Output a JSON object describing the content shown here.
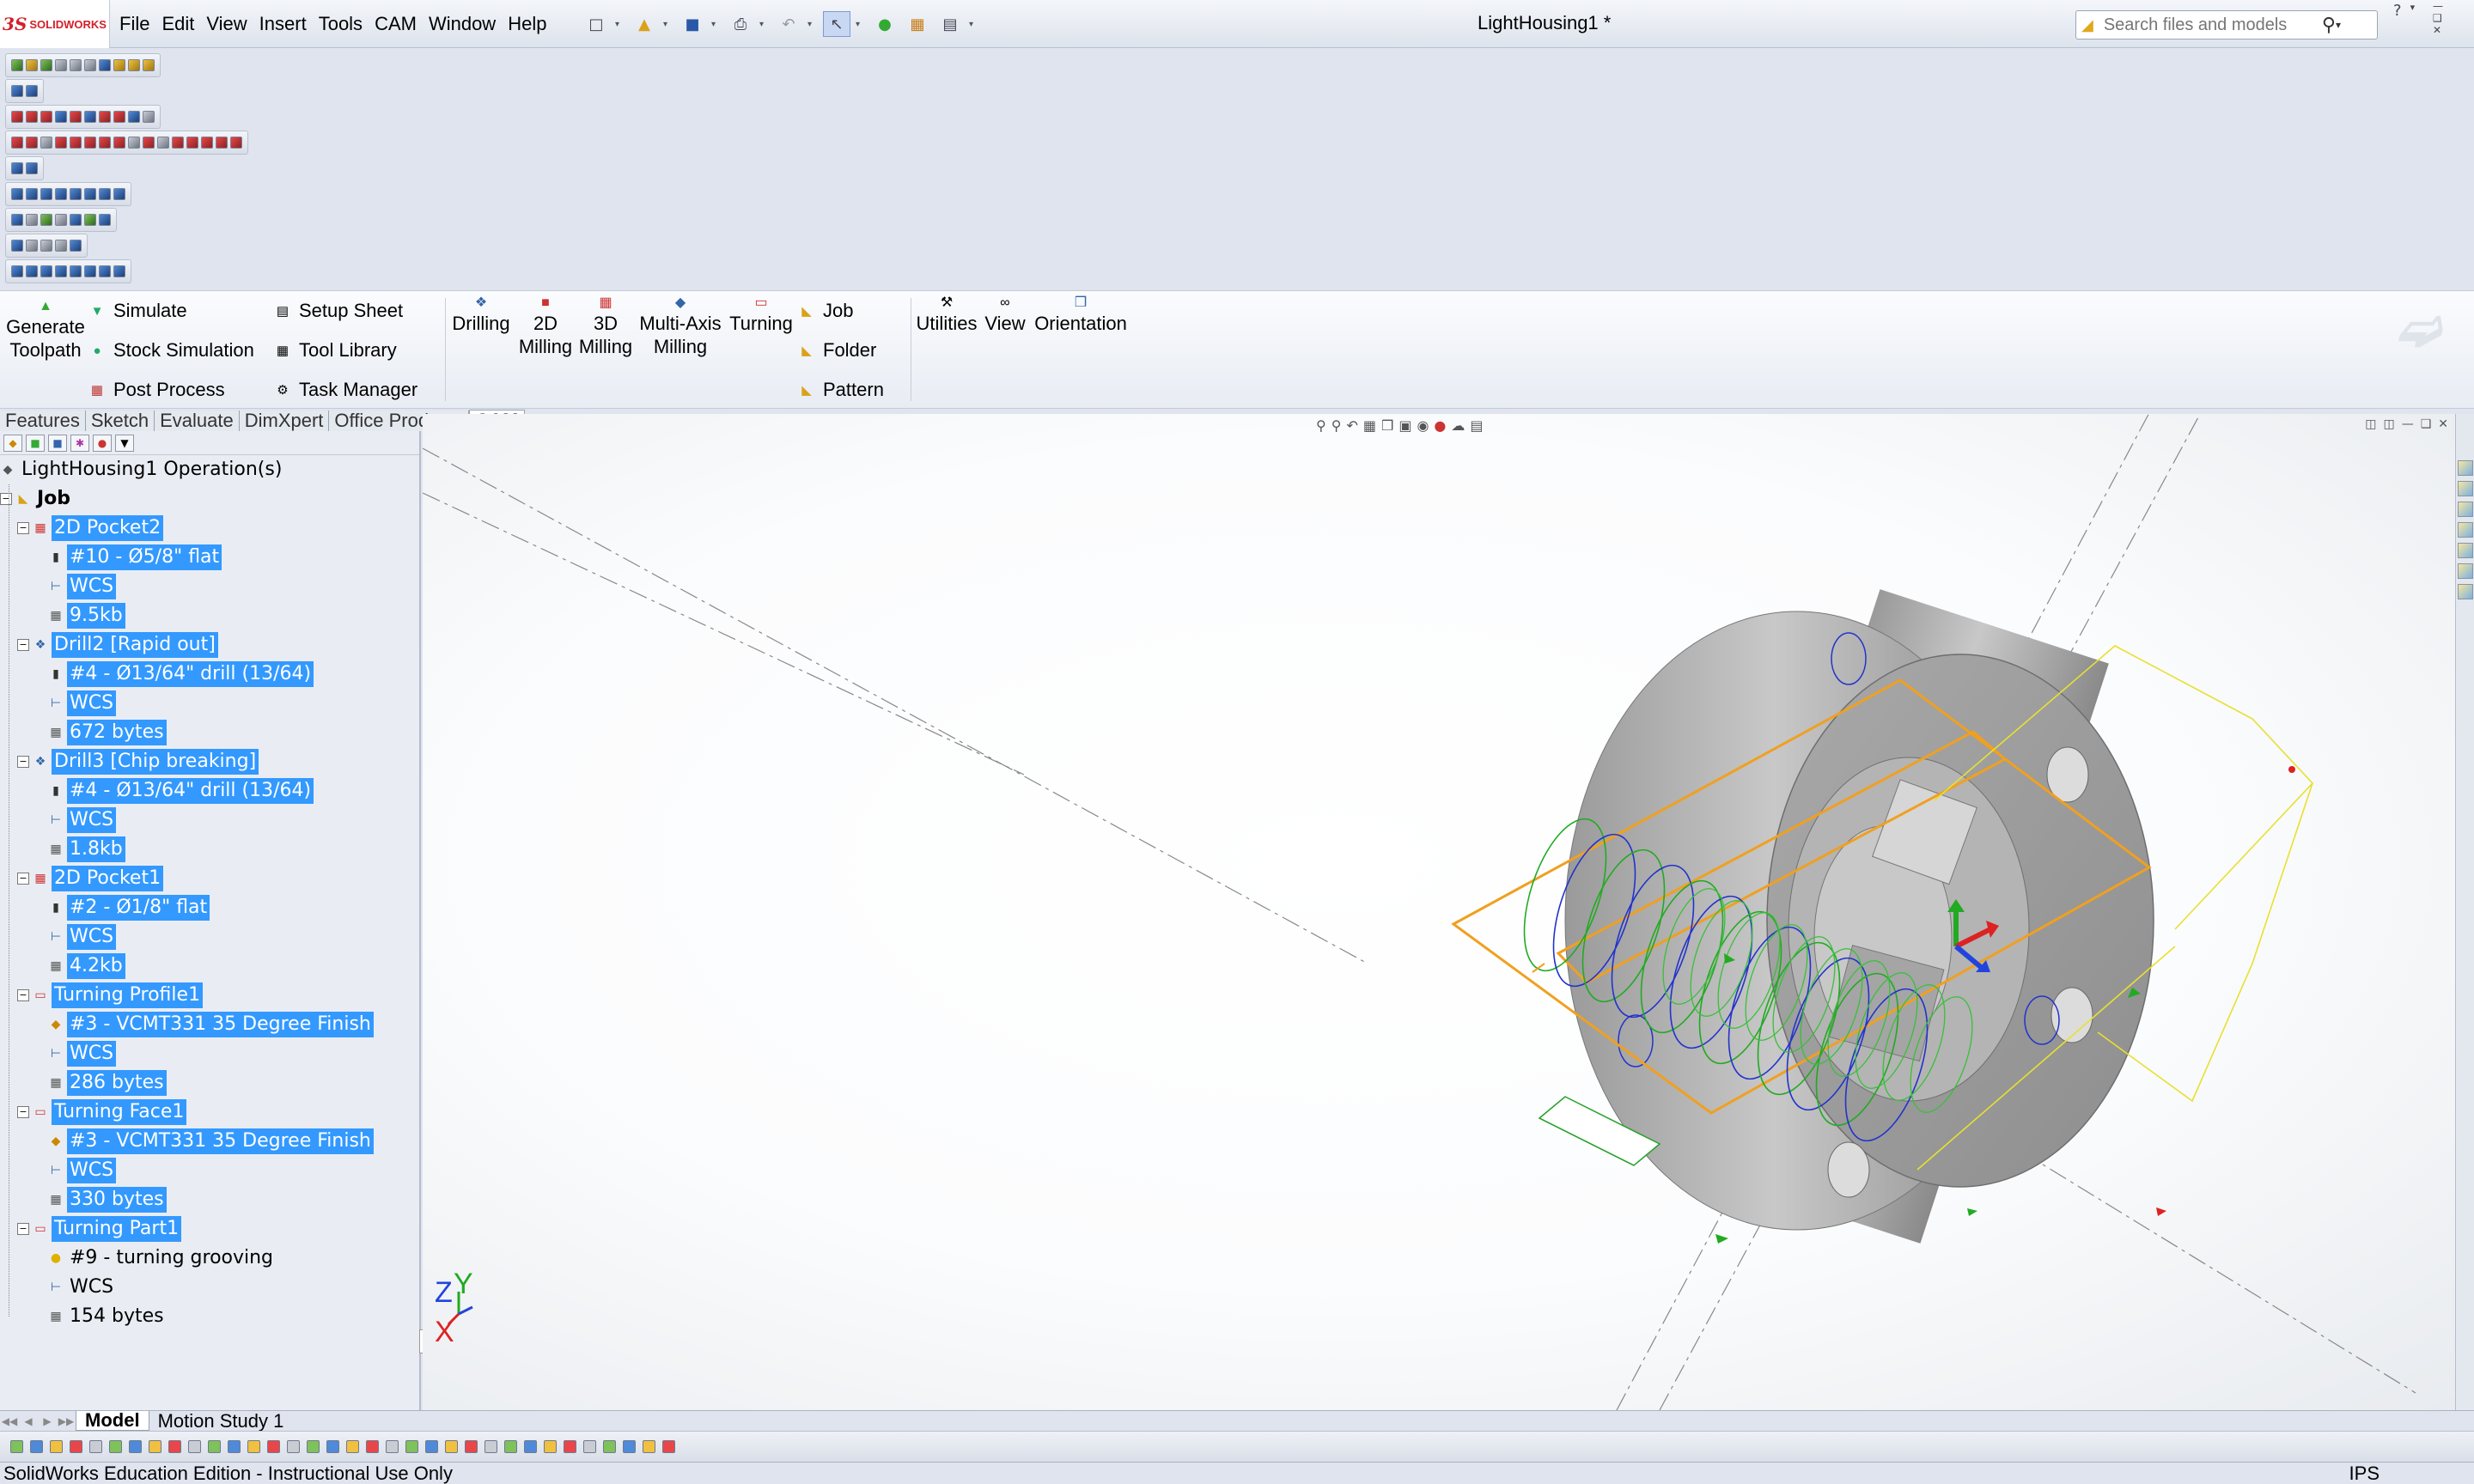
{
  "app": {
    "logo_mark": "3S",
    "logo_text": "SOLIDWORKS",
    "document_title": "LightHousing1 *"
  },
  "menu": [
    "File",
    "Edit",
    "View",
    "Insert",
    "Tools",
    "CAM",
    "Window",
    "Help"
  ],
  "search": {
    "placeholder": "Search files and models"
  },
  "cam_commands": {
    "generate_toolpath": "Generate Toolpath",
    "simulate": "Simulate",
    "stock_simulation": "Stock Simulation",
    "post_process": "Post Process",
    "setup_sheet": "Setup Sheet",
    "tool_library": "Tool Library",
    "task_manager": "Task Manager",
    "drilling": "Drilling",
    "milling_2d": "2D Milling",
    "milling_3d": "3D Milling",
    "multi_axis": "Multi-Axis Milling",
    "turning": "Turning",
    "job": "Job",
    "folder": "Folder",
    "pattern": "Pattern",
    "utilities": "Utilities",
    "view": "View",
    "orientation": "Orientation"
  },
  "tabs": [
    "Features",
    "Sketch",
    "Evaluate",
    "DimXpert",
    "Office Products",
    "CAM"
  ],
  "active_tab": "CAM",
  "tree": {
    "root": "LightHousing1 Operation(s)",
    "job": "Job",
    "operations": [
      {
        "name": "2D Pocket2",
        "tool": "#10 - Ø5/8\" flat",
        "wcs": "WCS",
        "size": "9.5kb"
      },
      {
        "name": "Drill2 [Rapid out]",
        "tool": "#4 - Ø13/64\" drill (13/64)",
        "wcs": "WCS",
        "size": "672 bytes"
      },
      {
        "name": "Drill3 [Chip breaking]",
        "tool": "#4 - Ø13/64\" drill (13/64)",
        "wcs": "WCS",
        "size": "1.8kb"
      },
      {
        "name": "2D Pocket1",
        "tool": "#2 - Ø1/8\" flat",
        "wcs": "WCS",
        "size": "4.2kb"
      },
      {
        "name": "Turning Profile1",
        "tool": "#3 - VCMT331 35 Degree Finish",
        "wcs": "WCS",
        "size": "286 bytes"
      },
      {
        "name": "Turning Face1",
        "tool": "#3 - VCMT331 35 Degree Finish",
        "wcs": "WCS",
        "size": "330 bytes"
      },
      {
        "name": "Turning Part1",
        "tool": "#9 - turning grooving",
        "wcs": "WCS",
        "size": "154 bytes"
      }
    ]
  },
  "axes": {
    "x": "X",
    "y": "Y",
    "z": "Z"
  },
  "bottom_tabs": [
    "Model",
    "Motion Study 1"
  ],
  "status": {
    "text": "SolidWorks Education Edition - Instructional Use Only",
    "units": "IPS"
  },
  "colors": {
    "selection": "#3399ff",
    "part_gray": "#b8b8b8",
    "toolpath_green": "#22aa22",
    "toolpath_blue": "#2233cc",
    "stock_orange": "#f0a020",
    "brand_red": "#d3202a"
  }
}
